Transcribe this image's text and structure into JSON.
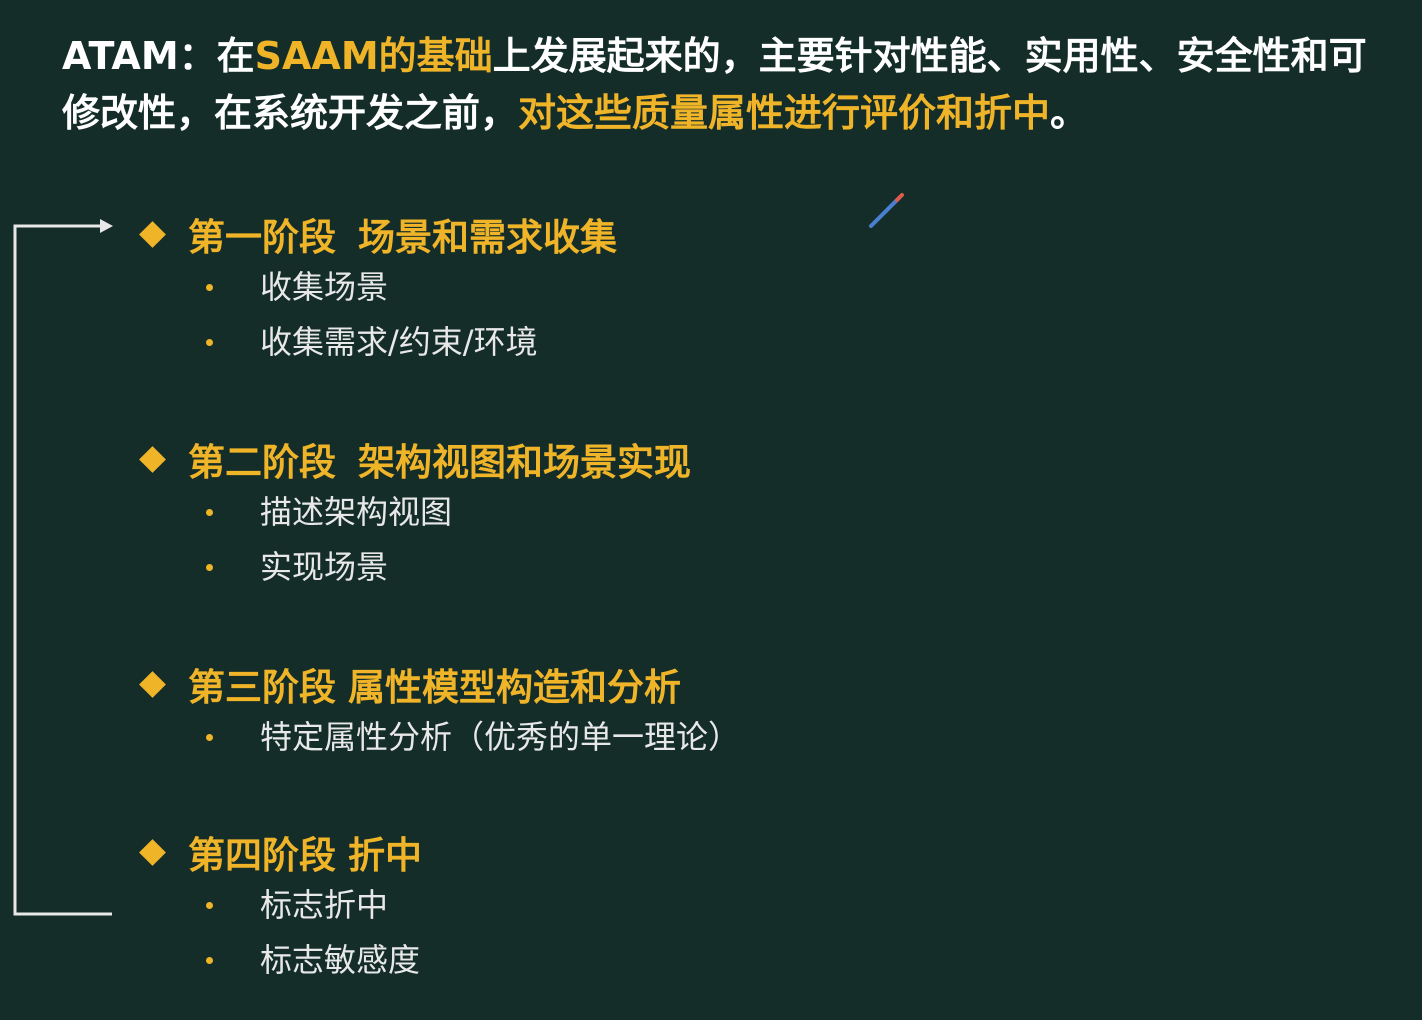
{
  "intro": {
    "prefix": "ATAM：在",
    "hl1": "SAAM的基础",
    "mid": "上发展起来的，主要针对性能、实用性、安全性和可修改性，在系统开发之前，",
    "hl2": "对这些质量属性进行评价和折中",
    "suffix": "。"
  },
  "stages": [
    {
      "label": "第一阶段",
      "name": "场景和需求收集",
      "items": [
        "收集场景",
        "收集需求/约束/环境"
      ]
    },
    {
      "label": "第二阶段",
      "name": "架构视图和场景实现",
      "items": [
        "描述架构视图",
        "实现场景"
      ]
    },
    {
      "label": "第三阶段",
      "name": "属性模型构造和分析",
      "items": [
        "特定属性分析（优秀的单一理论）"
      ]
    },
    {
      "label": "第四阶段",
      "name": "折中",
      "items": [
        "标志折中",
        "标志敏感度"
      ]
    }
  ],
  "icons": {
    "bullet": "diamond-icon",
    "item_bullet": "dot-icon",
    "loop_arrow": "loop-arrow-icon",
    "pen": "pen-cursor-icon"
  },
  "colors": {
    "background": "#142d29",
    "accent": "#f0b429",
    "text": "#ffffff"
  }
}
